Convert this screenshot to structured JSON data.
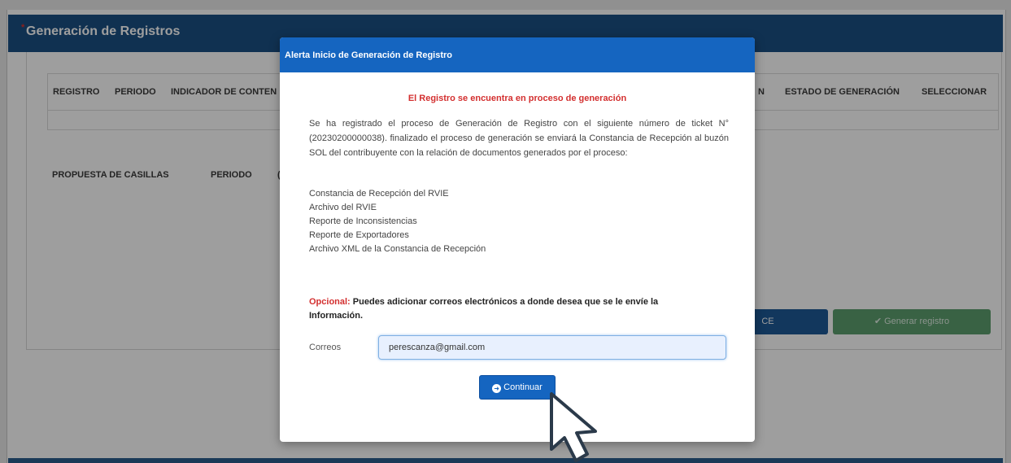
{
  "page": {
    "title": "Generación de Registros",
    "required_mark": "*",
    "table1_headers": [
      "REGISTRO",
      "PERIODO",
      "INDICADOR DE CONTEN",
      "N",
      "ESTADO DE GENERACIÓN",
      "SELECCIONAR"
    ],
    "table2_headers": [
      "PROPUESTA DE CASILLAS",
      "PERIODO",
      "("
    ],
    "btn_blue_label": "CE",
    "btn_green_label": "✔ Generar registro"
  },
  "modal": {
    "title": "Alerta Inicio de Generación de Registro",
    "heading": "El Registro se encuentra en proceso de generación",
    "description": "Se ha registrado el proceso de Generación de Registro con el siguiente número de ticket N° (20230200000038). finalizado el proceso de generación se enviará la Constancia de Recepción al buzón SOL del contribuyente con la relación de documentos generados por el proceso:",
    "documents": [
      "Constancia de Recepción del RVIE",
      "Archivo del RVIE",
      "Reporte de Inconsistencias",
      "Reporte de Exportadores",
      "Archivo XML de la Constancia de Recepción"
    ],
    "optional_label": "Opcional:",
    "optional_text": "Puedes adicionar correos electrónicos a donde desea que se le envíe la Información.",
    "email_label": "Correos",
    "email_value": "perescanza@gmail.com",
    "continue_label": "Continuar",
    "continue_icon": "arrow-circle-right-icon"
  },
  "colors": {
    "header_blue": "#1a4f83",
    "modal_header": "#1565c0",
    "alert_red": "#d32f2f",
    "success_green": "#5c9e6e"
  }
}
